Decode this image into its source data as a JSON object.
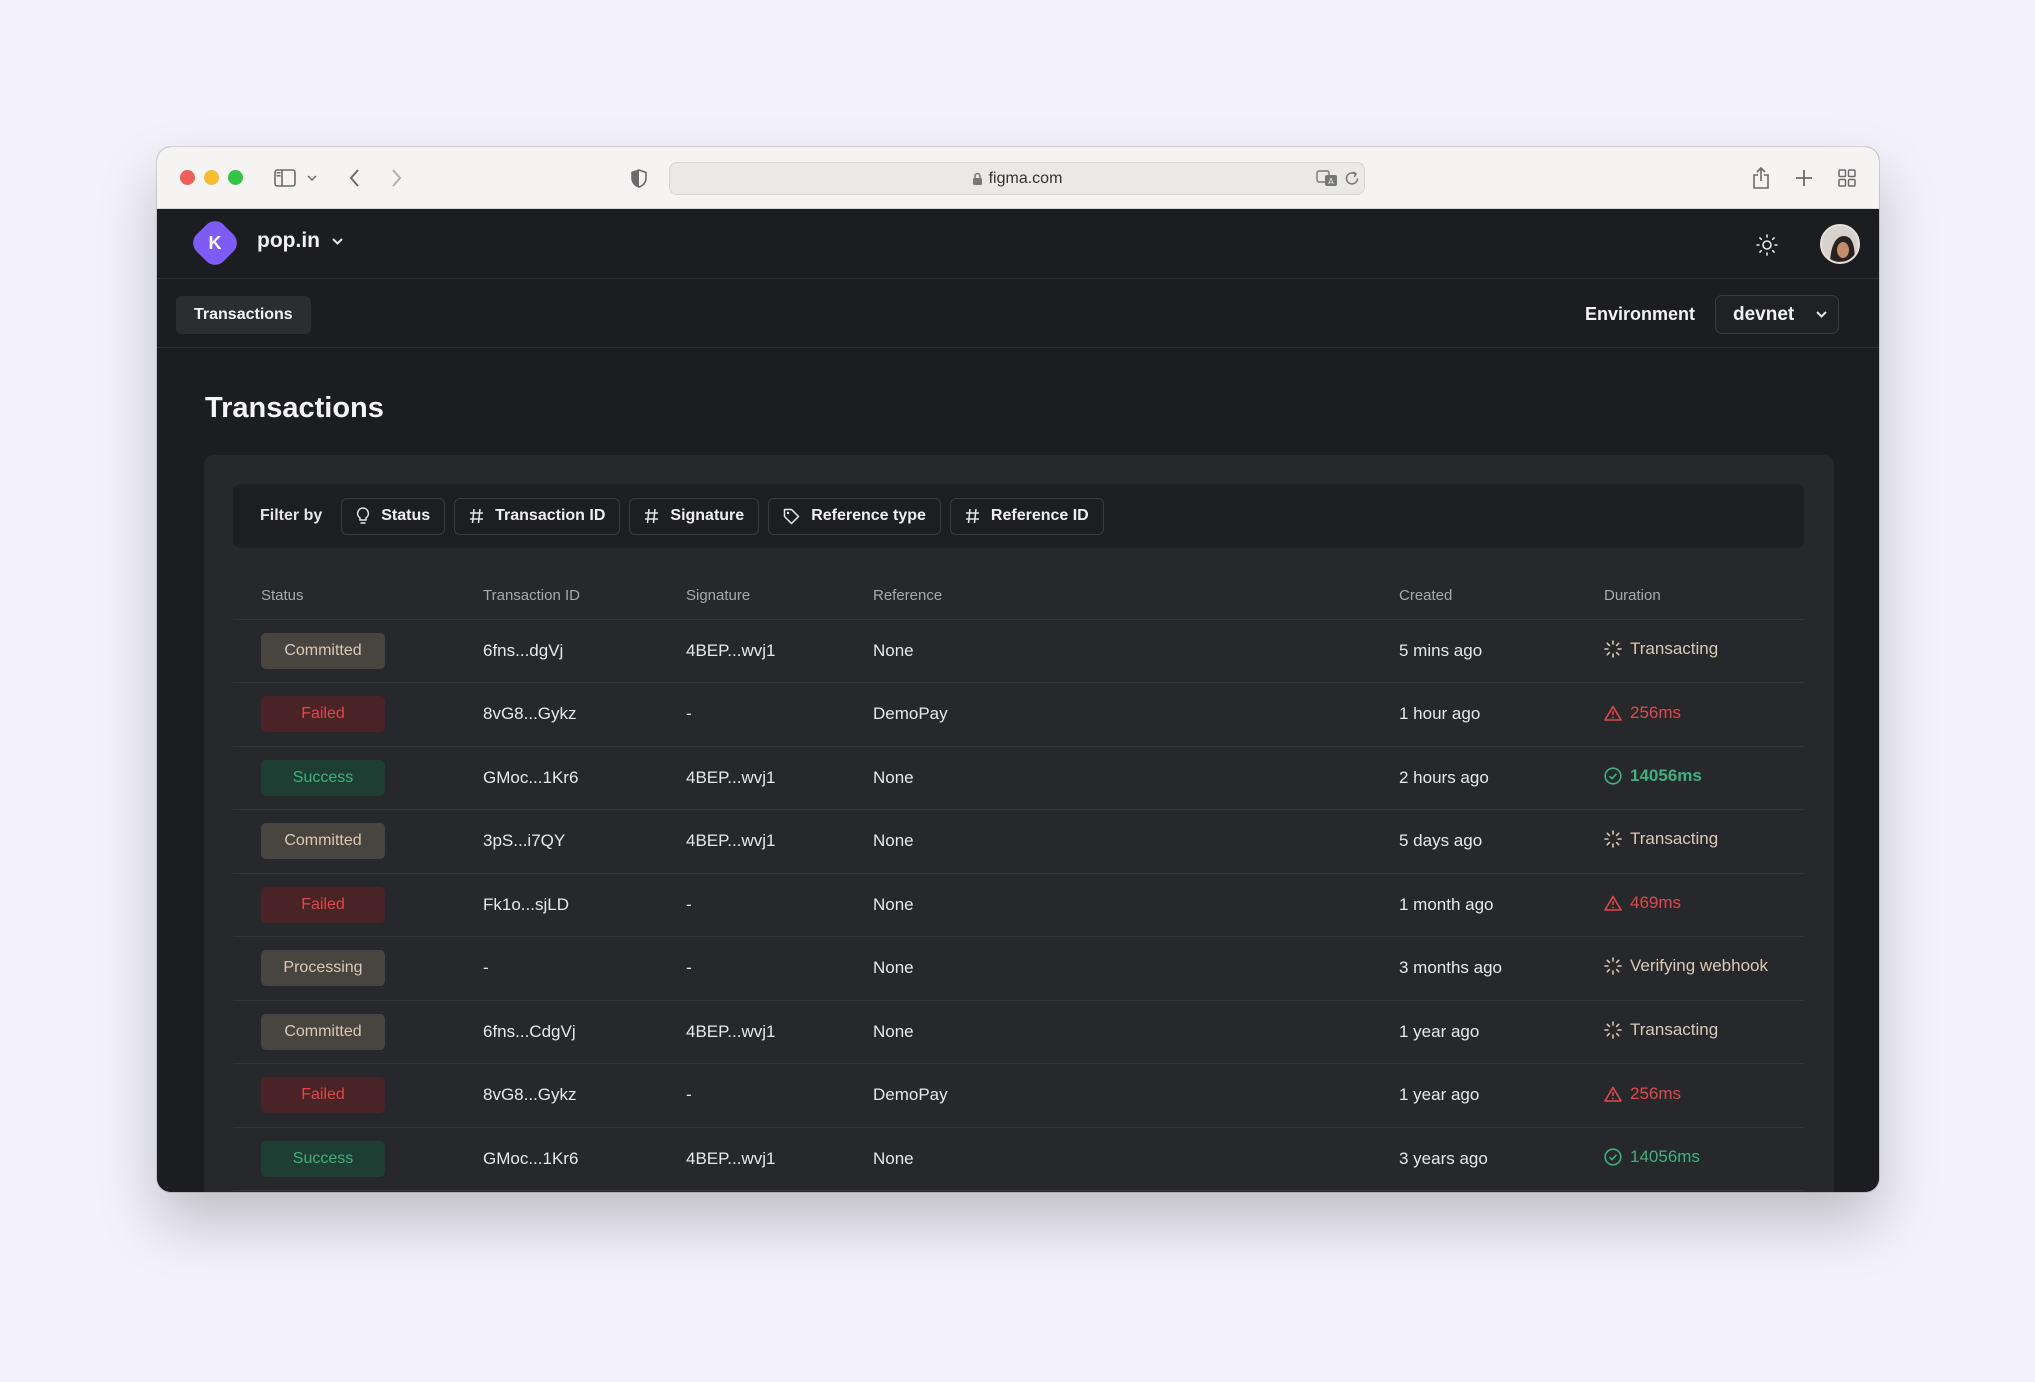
{
  "browser": {
    "url": "figma.com"
  },
  "app": {
    "workspace_name": "pop.in",
    "logo_letter": "K",
    "nav_tab": "Transactions",
    "environment_label": "Environment",
    "environment_value": "devnet"
  },
  "page": {
    "title": "Transactions"
  },
  "filters": {
    "label": "Filter by",
    "chips": [
      "Status",
      "Transaction ID",
      "Signature",
      "Reference type",
      "Reference ID"
    ]
  },
  "table": {
    "headers": [
      "Status",
      "Transaction ID",
      "Signature",
      "Reference",
      "Created",
      "Duration"
    ],
    "rows": [
      {
        "status": "Committed",
        "status_kind": "committed",
        "tx": "6fns...dgVj",
        "sig": "4BEP...wvj1",
        "ref": "None",
        "created": "5 mins ago",
        "duration": "Transacting",
        "duration_kind": "transacting"
      },
      {
        "status": "Failed",
        "status_kind": "failed",
        "tx": "8vG8...Gykz",
        "sig": "-",
        "ref": "DemoPay",
        "created": "1 hour ago",
        "duration": "256ms",
        "duration_kind": "failed"
      },
      {
        "status": "Success",
        "status_kind": "success",
        "tx": "GMoc...1Kr6",
        "sig": "4BEP...wvj1",
        "ref": "None",
        "created": "2 hours ago",
        "duration": "14056ms",
        "duration_kind": "success-bold"
      },
      {
        "status": "Committed",
        "status_kind": "committed",
        "tx": "3pS...i7QY",
        "sig": "4BEP...wvj1",
        "ref": "None",
        "created": "5 days ago",
        "duration": "Transacting",
        "duration_kind": "transacting"
      },
      {
        "status": "Failed",
        "status_kind": "failed",
        "tx": "Fk1o...sjLD",
        "sig": "-",
        "ref": "None",
        "created": "1 month ago",
        "duration": "469ms",
        "duration_kind": "failed"
      },
      {
        "status": "Processing",
        "status_kind": "processing",
        "tx": "-",
        "sig": "-",
        "ref": "None",
        "created": "3 months ago",
        "duration": "Verifying webhook",
        "duration_kind": "transacting"
      },
      {
        "status": "Committed",
        "status_kind": "committed",
        "tx": "6fns...CdgVj",
        "sig": "4BEP...wvj1",
        "ref": "None",
        "created": "1 year ago",
        "duration": "Transacting",
        "duration_kind": "transacting"
      },
      {
        "status": "Failed",
        "status_kind": "failed",
        "tx": "8vG8...Gykz",
        "sig": "-",
        "ref": "DemoPay",
        "created": "1 year ago",
        "duration": "256ms",
        "duration_kind": "failed"
      },
      {
        "status": "Success",
        "status_kind": "success",
        "tx": "GMoc...1Kr6",
        "sig": "4BEP...wvj1",
        "ref": "None",
        "created": "3 years ago",
        "duration": "14056ms",
        "duration_kind": "success"
      }
    ]
  },
  "colors": {
    "accent": "#7c5cf5",
    "failed": "#e0494a",
    "success": "#3fb07e",
    "pending": "#d9c9b5"
  }
}
